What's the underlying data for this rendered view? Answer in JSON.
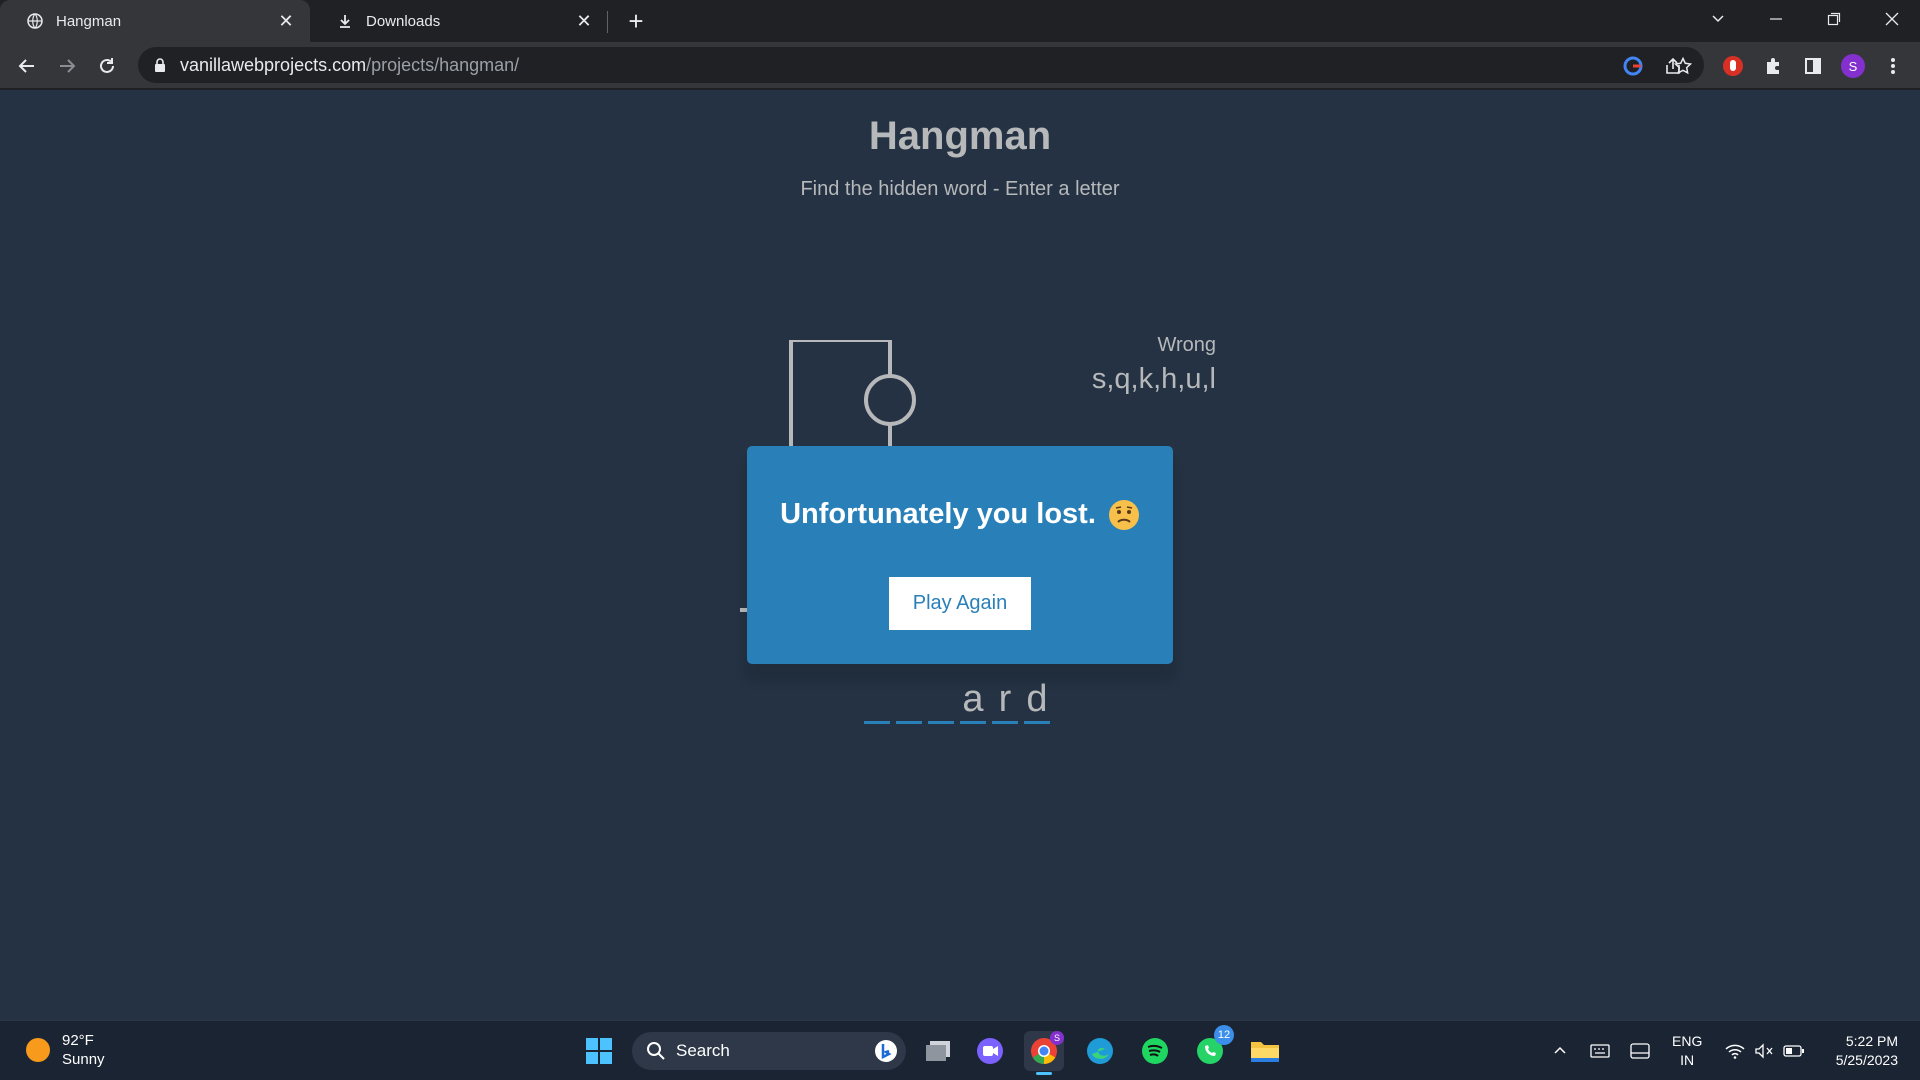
{
  "browser": {
    "tabs": [
      {
        "label": "Hangman",
        "icon": "globe-icon",
        "active": true
      },
      {
        "label": "Downloads",
        "icon": "download-icon",
        "active": false
      }
    ],
    "new_tab_label": "+",
    "url_host": "vanillawebprojects.com",
    "url_path": "/projects/hangman/",
    "profile_initial": "S"
  },
  "page": {
    "title": "Hangman",
    "subtitle": "Find the hidden word - Enter a letter",
    "wrong_label": "Wrong",
    "wrong_letters": "s,q,k,h,u,l",
    "word_letters": [
      "",
      "",
      "",
      "a",
      "r",
      "d"
    ]
  },
  "popup": {
    "message": "Unfortunately you lost.",
    "play_again_label": "Play Again"
  },
  "taskbar": {
    "weather_temp": "92°F",
    "weather_desc": "Sunny",
    "search_label": "Search",
    "whatsapp_badge": "12",
    "lang_top": "ENG",
    "lang_bottom": "IN",
    "time": "5:22 PM",
    "date": "5/25/2023"
  },
  "colors": {
    "page_bg": "#243243",
    "accent": "#2980b9",
    "text": "#b6b8ba"
  }
}
